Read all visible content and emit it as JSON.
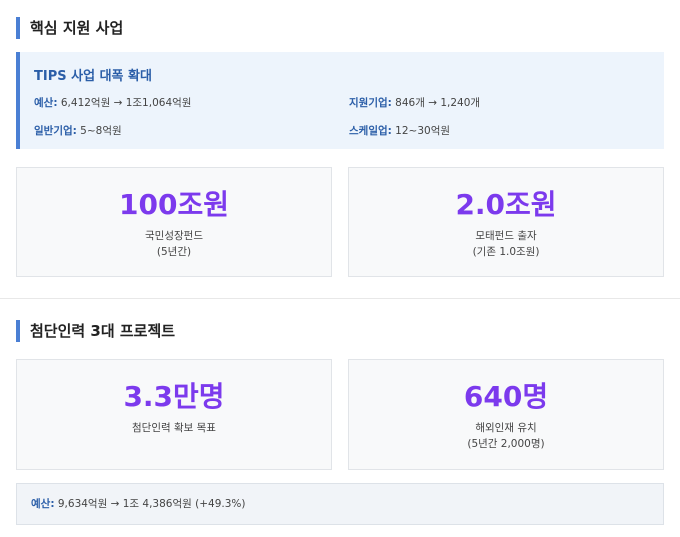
{
  "section1": {
    "title": "핵심 지원 사업",
    "tips": {
      "title": "TIPS 사업 대폭 확대",
      "items": [
        {
          "key": "예산:",
          "value": " 6,412억원 → 1조1,064억원"
        },
        {
          "key": "지원기업:",
          "value": " 846개 → 1,240개"
        },
        {
          "key": "일반기업:",
          "value": " 5~8억원"
        },
        {
          "key": "스케일업:",
          "value": " 12~30억원"
        }
      ]
    },
    "stats": [
      {
        "value": "100조원",
        "label": "국민성장펀드",
        "sub": "(5년간)"
      },
      {
        "value": "2.0조원",
        "label": "모태펀드 출자",
        "sub": "(기존 1.0조원)"
      }
    ]
  },
  "section2": {
    "title": "첨단인력 3대 프로젝트",
    "stats": [
      {
        "value": "3.3만명",
        "label": "첨단인력 확보 목표",
        "sub": ""
      },
      {
        "value": "640명",
        "label": "해외인재 유치",
        "sub": "(5년간 2,000명)"
      }
    ],
    "budget": {
      "key": "예산:",
      "value": " 9,634억원 → 1조 4,386억원 (+49.3%)"
    }
  },
  "colors": {
    "accent": "#4a7fd4",
    "highlight": "#7c3aed",
    "tips_bg": "#edf4fc"
  }
}
